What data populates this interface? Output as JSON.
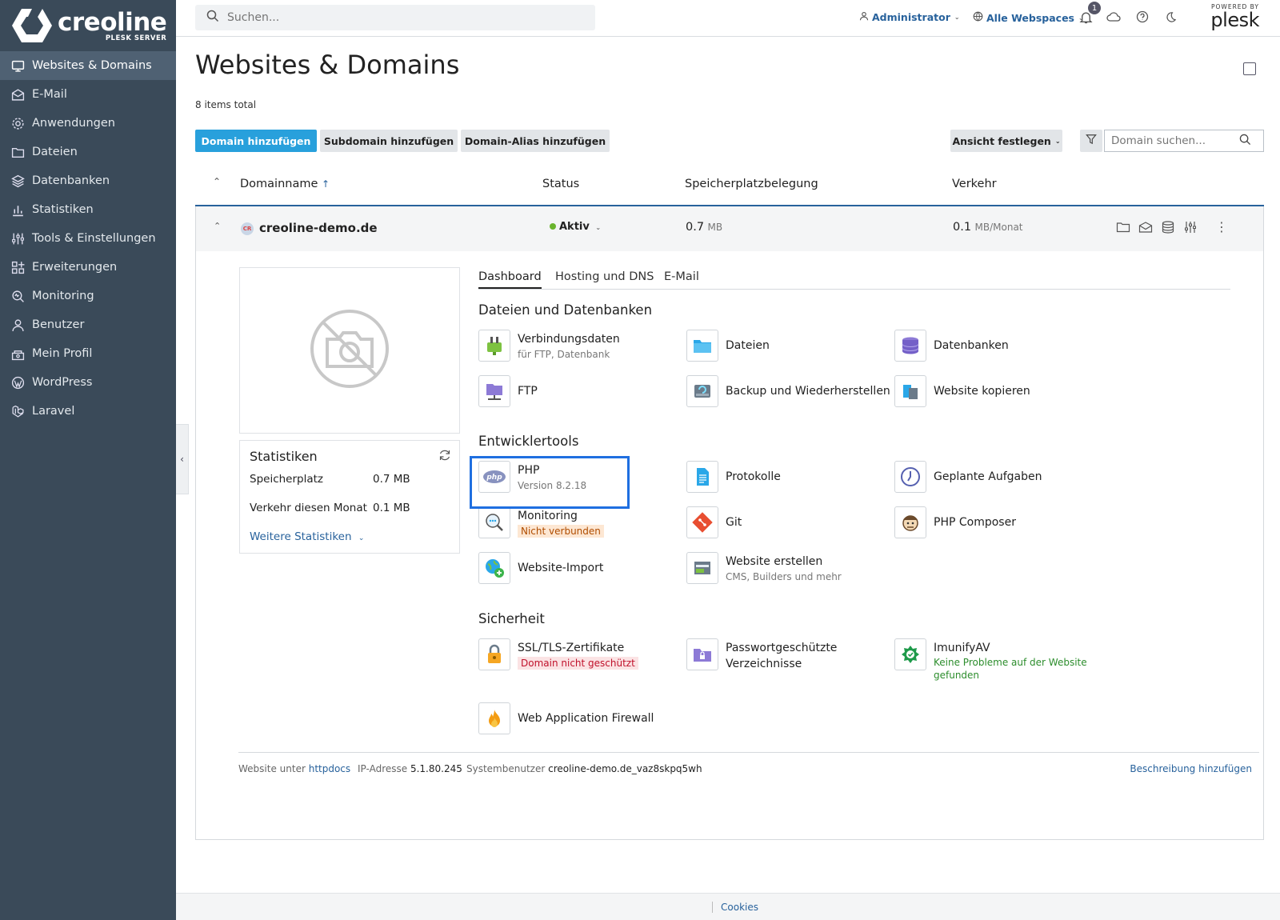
{
  "brand": {
    "name": "creoline",
    "sub": "PLESK SERVER"
  },
  "sidebar": {
    "items": [
      {
        "label": "Websites & Domains",
        "icon": "monitor-icon"
      },
      {
        "label": "E-Mail",
        "icon": "mail-icon"
      },
      {
        "label": "Anwendungen",
        "icon": "gear-icon"
      },
      {
        "label": "Dateien",
        "icon": "folder-icon"
      },
      {
        "label": "Datenbanken",
        "icon": "database-icon"
      },
      {
        "label": "Statistiken",
        "icon": "bar-chart-icon"
      },
      {
        "label": "Tools & Einstellungen",
        "icon": "sliders-icon"
      },
      {
        "label": "Erweiterungen",
        "icon": "grid-icon"
      },
      {
        "label": "Monitoring",
        "icon": "magnifier-icon"
      },
      {
        "label": "Benutzer",
        "icon": "user-icon"
      },
      {
        "label": "Mein Profil",
        "icon": "profile-icon"
      },
      {
        "label": "WordPress",
        "icon": "wordpress-icon"
      },
      {
        "label": "Laravel",
        "icon": "laravel-icon"
      }
    ]
  },
  "topbar": {
    "search_placeholder": "Suchen...",
    "user": "Administrator",
    "webspaces": "Alle Webspaces",
    "notifications_count": "1",
    "powered_by": "POWERED BY",
    "plesk": "plesk"
  },
  "page": {
    "title": "Websites & Domains",
    "items_total": "8 items total",
    "buttons": {
      "add_domain": "Domain hinzufügen",
      "add_subdomain": "Subdomain hinzufügen",
      "add_alias": "Domain-Alias hinzufügen",
      "view": "Ansicht festlegen"
    },
    "domain_search_placeholder": "Domain suchen..."
  },
  "table": {
    "headers": {
      "name": "Domainname",
      "status": "Status",
      "disk": "Speicherplatzbelegung",
      "traffic": "Verkehr"
    }
  },
  "domain": {
    "avatar": "CR",
    "name": "creoline-demo.de",
    "status": "Aktiv",
    "disk_value": "0.7",
    "disk_unit": "MB",
    "traffic_value": "0.1",
    "traffic_unit": "MB/Monat"
  },
  "stats": {
    "title": "Statistiken",
    "disk_label": "Speicherplatz",
    "disk_value": "0.7 MB",
    "traffic_label": "Verkehr diesen Monat",
    "traffic_value": "0.1 MB",
    "more": "Weitere Statistiken"
  },
  "tabs": [
    "Dashboard",
    "Hosting und DNS",
    "E-Mail"
  ],
  "sections": {
    "files": {
      "title": "Dateien und Datenbanken",
      "connection": {
        "label": "Verbindungsdaten",
        "sub": "für FTP, Datenbank"
      },
      "files": {
        "label": "Dateien"
      },
      "databases": {
        "label": "Datenbanken"
      },
      "ftp": {
        "label": "FTP"
      },
      "backup": {
        "label": "Backup und Wiederherstellen"
      },
      "copy": {
        "label": "Website kopieren"
      }
    },
    "dev": {
      "title": "Entwicklertools",
      "php": {
        "label": "PHP",
        "sub": "Version 8.2.18"
      },
      "logs": {
        "label": "Protokolle"
      },
      "tasks": {
        "label": "Geplante Aufgaben"
      },
      "monitoring": {
        "label": "Monitoring",
        "sub": "Nicht verbunden"
      },
      "git": {
        "label": "Git"
      },
      "composer": {
        "label": "PHP Composer"
      },
      "import": {
        "label": "Website-Import"
      },
      "builder": {
        "label": "Website erstellen",
        "sub": "CMS, Builders und mehr"
      }
    },
    "security": {
      "title": "Sicherheit",
      "ssl": {
        "label": "SSL/TLS-Zertifikate",
        "sub": "Domain nicht geschützt"
      },
      "protected": {
        "label1": "Passwortgeschützte",
        "label2": "Verzeichnisse"
      },
      "imunify": {
        "label": "ImunifyAV",
        "sub1": "Keine Probleme auf der Website",
        "sub2": "gefunden"
      },
      "waf": {
        "label": "Web Application Firewall"
      }
    }
  },
  "panel_footer": {
    "site_prefix": "Website unter",
    "site_dir": "httpdocs",
    "ip_label": "IP-Adresse",
    "ip": "5.1.80.245",
    "sysuser_label": "Systembenutzer",
    "sysuser": "creoline-demo.de_vaz8skpq5wh",
    "add_description": "Beschreibung hinzufügen"
  },
  "footer": {
    "cookies": "Cookies"
  },
  "colors": {
    "sidebar": "#3a4a59",
    "accent": "#28a0dc",
    "link": "#28629c",
    "highlight": "#1f6fe0",
    "active_dot": "#6ab42d"
  }
}
